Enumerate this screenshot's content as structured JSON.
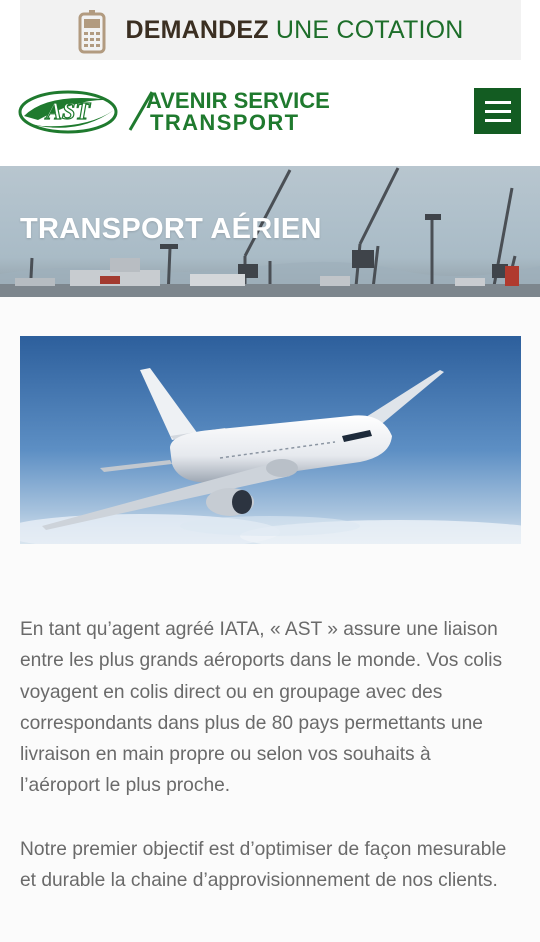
{
  "quote_banner": {
    "label_part1": "DEMANDEZ",
    "label_part2": "UNE COTATION",
    "icon": "mobile-phone-icon"
  },
  "header": {
    "logo_badge": "AST",
    "logo_line1": "AVENIR SERVICE",
    "logo_line2": "TRANSPORT",
    "menu_icon": "hamburger-menu-icon"
  },
  "hero": {
    "title": "TRANSPORT AÉRIEN"
  },
  "content": {
    "paragraph1": "En tant qu’agent agréé IATA, « AST » assure une liaison entre les plus grands aéroports dans le monde. Vos colis voyagent en colis direct ou en groupage avec des correspondants dans plus de 80 pays permettants une livraison en main propre ou selon vos souhaits à l’aéroport le plus proche.",
    "paragraph2": "Notre premier objectif est d’optimiser de façon mesurable et durable la chaine d’approvisionnement de nos clients."
  },
  "colors": {
    "brand_green": "#135c22",
    "brand_green_text": "#1d6e2a",
    "dark_brown": "#3b2f22",
    "body_text": "#6a6a6a"
  }
}
